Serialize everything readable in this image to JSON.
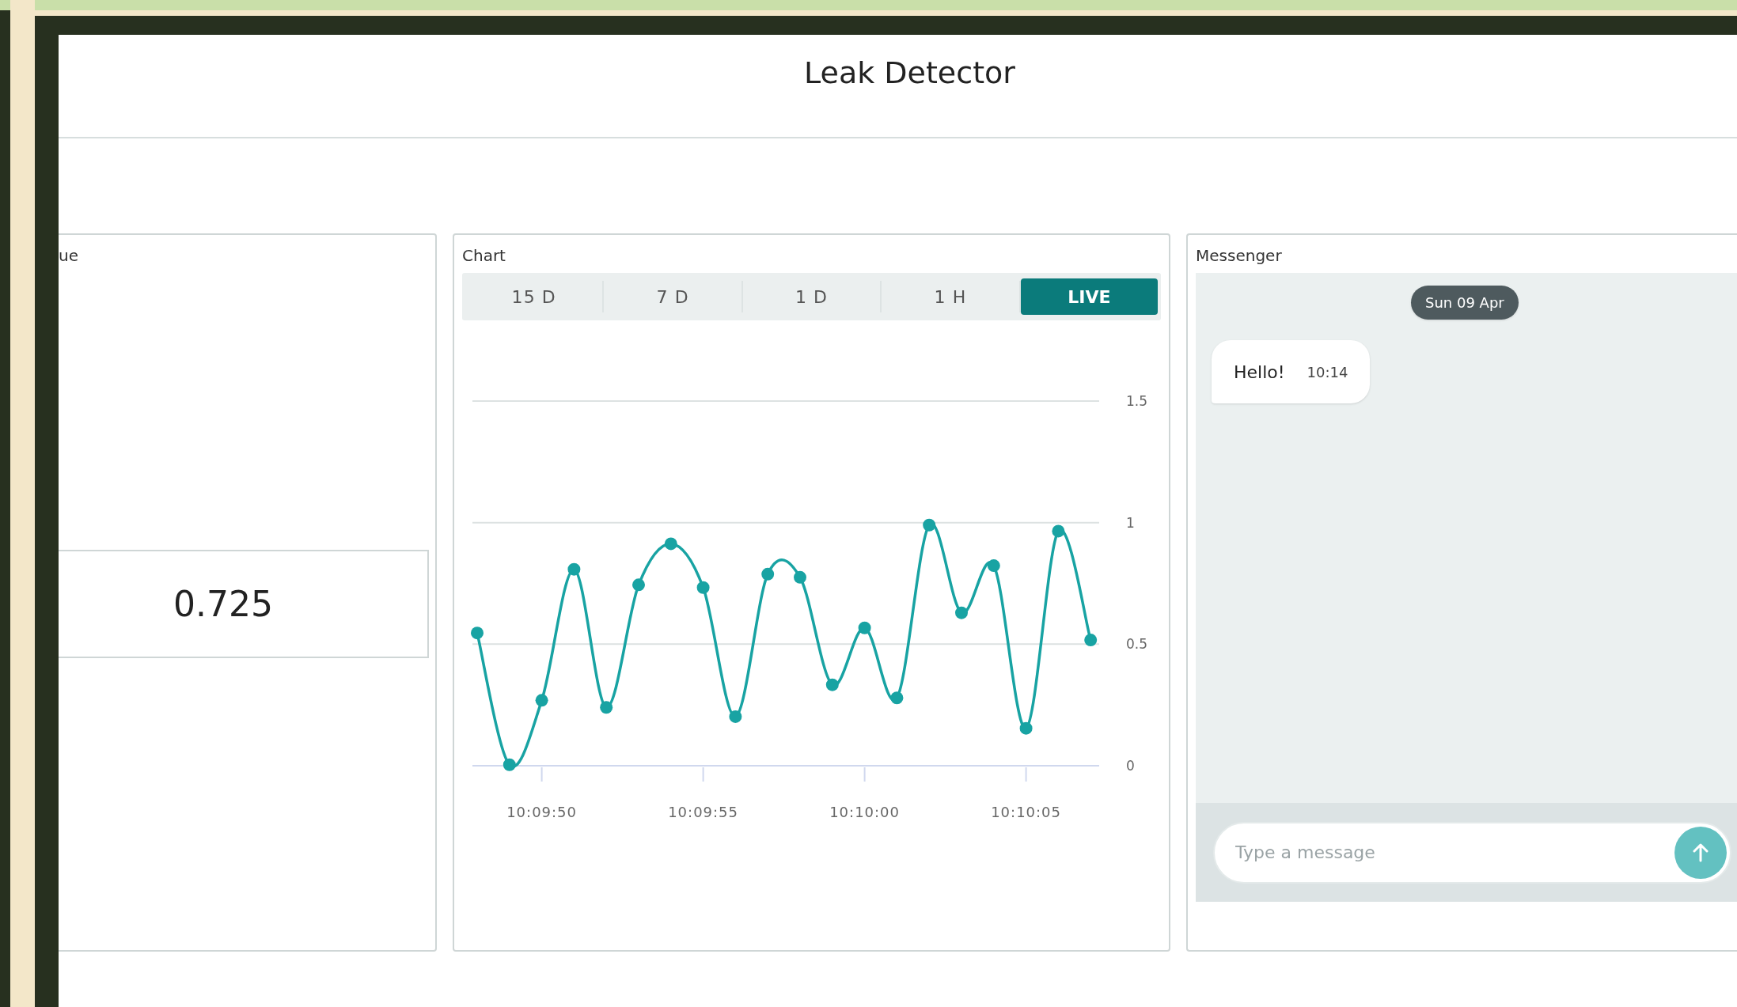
{
  "page": {
    "title": "Leak Detector"
  },
  "value_widget": {
    "title": "ue",
    "value": "0.725"
  },
  "chart_widget": {
    "title": "Chart",
    "tabs": [
      {
        "label": "15 D",
        "selected": false
      },
      {
        "label": "7 D",
        "selected": false
      },
      {
        "label": "1 D",
        "selected": false
      },
      {
        "label": "1 H",
        "selected": false
      },
      {
        "label": "LIVE",
        "selected": true
      }
    ],
    "chart_data": {
      "type": "line",
      "categories": [
        null,
        null,
        "10:09:50",
        null,
        null,
        null,
        null,
        "10:09:55",
        null,
        null,
        null,
        null,
        "10:10:00",
        null,
        null,
        null,
        null,
        "10:10:05",
        null,
        null
      ],
      "grid": true,
      "series": [
        {
          "color": "#18a3a3",
          "marker": true,
          "values": [
            0.546,
            0.004,
            0.269,
            0.808,
            0.24,
            0.744,
            0.913,
            0.733,
            0.202,
            0.788,
            0.775,
            0.333,
            0.567,
            0.279,
            0.99,
            0.629,
            0.823,
            0.154,
            0.965,
            0.517
          ]
        }
      ],
      "ylim": [
        0,
        1.5
      ],
      "yticks": [
        0,
        0.5,
        1,
        1.5
      ]
    }
  },
  "messenger": {
    "title": "Messenger",
    "date": "Sun 09 Apr",
    "messages": [
      {
        "text": "Hello!",
        "time": "10:14"
      }
    ],
    "input": {
      "placeholder": "Type a message"
    }
  }
}
